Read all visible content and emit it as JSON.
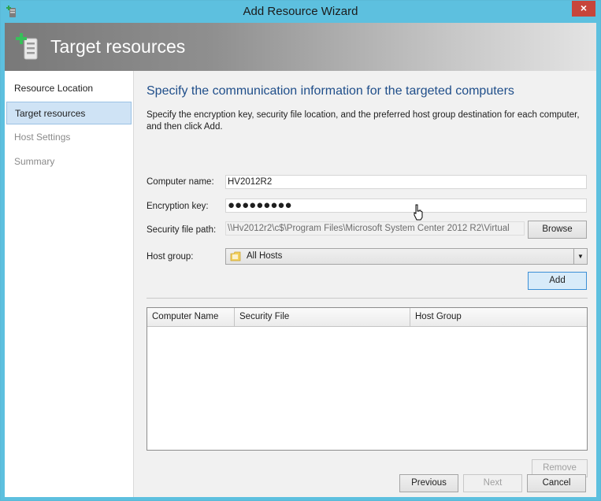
{
  "window": {
    "title": "Add Resource Wizard",
    "close_glyph": "×",
    "app_icon": "server-add-icon"
  },
  "banner": {
    "title": "Target resources",
    "icon": "server-add-icon"
  },
  "sidebar": {
    "items": [
      {
        "label": "Resource Location",
        "state": "normal"
      },
      {
        "label": "Target resources",
        "state": "active"
      },
      {
        "label": "Host Settings",
        "state": "disabled"
      },
      {
        "label": "Summary",
        "state": "disabled"
      }
    ]
  },
  "main": {
    "heading": "Specify the communication information for the targeted computers",
    "description": "Specify the encryption key, security file location, and the preferred host group destination for each computer, and then click Add.",
    "fields": {
      "computer_name_label": "Computer name:",
      "computer_name_value": "HV2012R2",
      "encryption_key_label": "Encryption key:",
      "encryption_key_value": "●●●●●●●●●",
      "security_file_label": "Security file path:",
      "security_file_value": "\\\\Hv2012r2\\c$\\Program Files\\Microsoft System Center 2012 R2\\Virtual",
      "browse_label": "Browse",
      "host_group_label": "Host group:",
      "host_group_value": "All Hosts",
      "host_group_icon": "folder-icon"
    },
    "add_label": "Add",
    "grid": {
      "columns": [
        "Computer Name",
        "Security File",
        "Host Group"
      ],
      "rows": []
    },
    "remove_label": "Remove"
  },
  "footer": {
    "previous_label": "Previous",
    "next_label": "Next",
    "cancel_label": "Cancel"
  },
  "colors": {
    "titlebar": "#5dc0df",
    "heading": "#1f4e8a",
    "close": "#c7453b"
  }
}
